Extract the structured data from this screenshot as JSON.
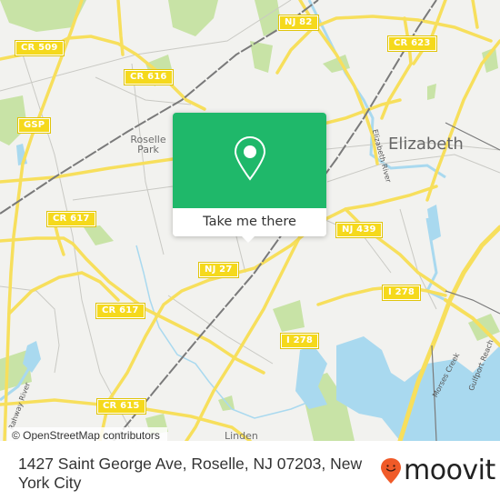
{
  "map": {
    "colors": {
      "land": "#f2f2ef",
      "park": "#c8e3a6",
      "water": "#a9d9ef",
      "road_major": "#f7df5c",
      "road_minor": "#c9c9c4",
      "rail": "#7a7a7a",
      "shield_bg": "#f5d91c"
    },
    "road_shields": [
      {
        "id": "cr509",
        "label": "CR 509"
      },
      {
        "id": "cr616",
        "label": "CR 616"
      },
      {
        "id": "gsp",
        "label": "GSP"
      },
      {
        "id": "nj82",
        "label": "NJ 82"
      },
      {
        "id": "cr623",
        "label": "CR 623"
      },
      {
        "id": "cr617a",
        "label": "CR 617"
      },
      {
        "id": "cr617b",
        "label": "CR 617"
      },
      {
        "id": "nj27",
        "label": "NJ 27"
      },
      {
        "id": "nj439",
        "label": "NJ 439"
      },
      {
        "id": "i278a",
        "label": "I 278"
      },
      {
        "id": "i278b",
        "label": "I 278"
      },
      {
        "id": "cr615",
        "label": "CR 615"
      }
    ],
    "places": {
      "roselle_park_line1": "Roselle",
      "roselle_park_line2": "Park",
      "elizabeth": "Elizabeth",
      "linden": "Linden"
    },
    "water_labels": {
      "elizabeth_river": "Elizabeth River",
      "rahway_river": "Rahway River",
      "morses_creek": "Morses Creek",
      "gulfport_reach": "Gulfport Reach"
    },
    "attribution": "© OpenStreetMap contributors"
  },
  "popup": {
    "icon": "location-pin-icon",
    "button_label": "Take me there",
    "color": "#1fb86a"
  },
  "footer": {
    "address": "1427 Saint George Ave, Roselle, NJ 07203, New York City",
    "logo_text": "moovit",
    "logo_icon": "moovit-smiley-pin-icon",
    "logo_color": "#f05a28"
  }
}
